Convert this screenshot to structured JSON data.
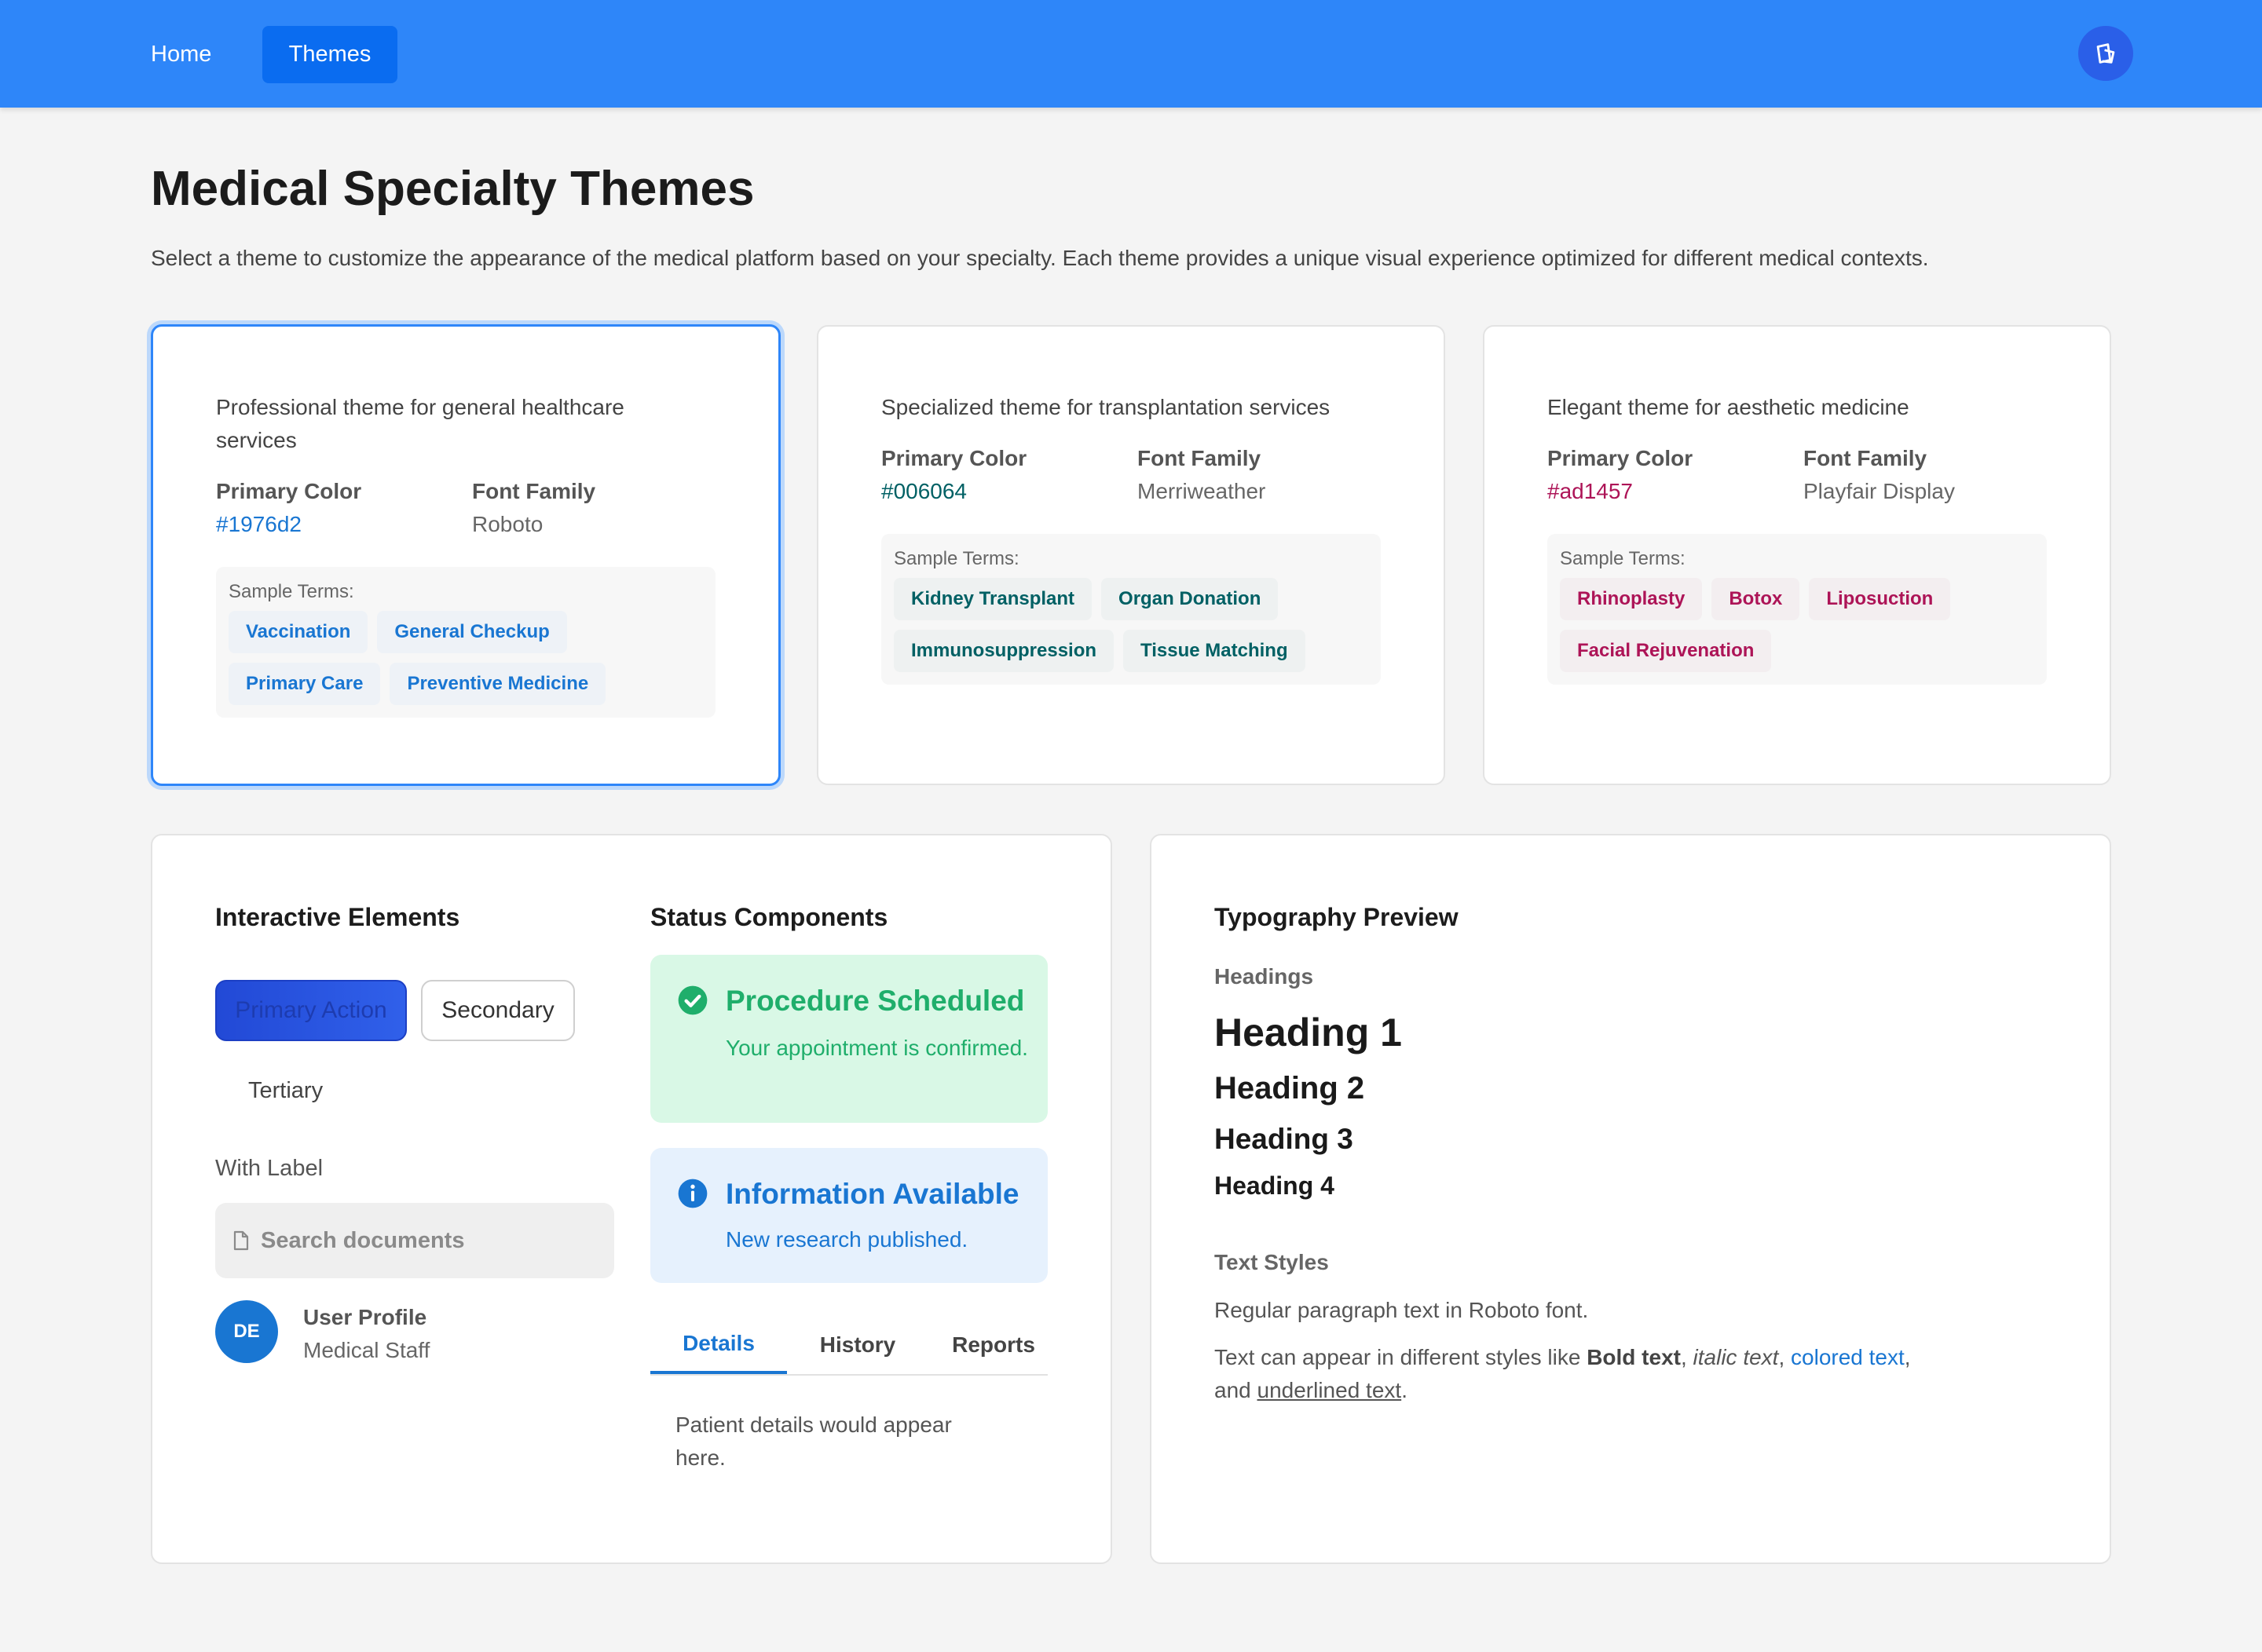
{
  "nav": {
    "home_label": "Home",
    "themes_label": "Themes",
    "avatar_icon": "theme-toggle-icon"
  },
  "page": {
    "title": "Medical Specialty Themes",
    "description": "Select a theme to customize the appearance of the medical platform based on your specialty. Each theme provides a unique visual experience optimized for different medical contexts."
  },
  "theme_cards": [
    {
      "description": "Professional theme for general healthcare services",
      "primary_color_label": "Primary Color",
      "primary_color": "#1976d2",
      "font_family_label": "Font Family",
      "font_family": "Roboto",
      "terms_label": "Sample Terms:",
      "terms": [
        "Vaccination",
        "General Checkup",
        "Primary Care",
        "Preventive Medicine"
      ],
      "chip_bg": "#eef2f7",
      "selected": true
    },
    {
      "description": "Specialized theme for transplantation services",
      "primary_color_label": "Primary Color",
      "primary_color": "#006064",
      "font_family_label": "Font Family",
      "font_family": "Merriweather",
      "terms_label": "Sample Terms:",
      "terms": [
        "Kidney Transplant",
        "Organ Donation",
        "Immunosuppression",
        "Tissue Matching"
      ],
      "chip_bg": "#eef1f1",
      "selected": false
    },
    {
      "description": "Elegant theme for aesthetic medicine",
      "primary_color_label": "Primary Color",
      "primary_color": "#ad1457",
      "font_family_label": "Font Family",
      "font_family": "Playfair Display",
      "terms_label": "Sample Terms:",
      "terms": [
        "Rhinoplasty",
        "Botox",
        "Liposuction",
        "Facial Rejuvenation"
      ],
      "chip_bg": "#f3eef0",
      "selected": false
    }
  ],
  "interactive": {
    "title": "Interactive Elements",
    "primary_button": "Primary Action",
    "secondary_button": "Secondary",
    "tertiary_button": "Tertiary",
    "field_label": "With Label",
    "search_placeholder": "Search documents",
    "avatar_initials": "DE",
    "profile_name": "User Profile",
    "profile_role": "Medical Staff"
  },
  "status": {
    "title": "Status Components",
    "success": {
      "title": "Procedure Scheduled",
      "message": "Your appointment is confirmed.",
      "color": "#1fae6b"
    },
    "info": {
      "title": "Information Available",
      "message": "New research published.",
      "color": "#1976d2"
    },
    "tabs": [
      "Details",
      "History",
      "Reports"
    ],
    "active_tab": "Details",
    "tab_content": "Patient details would appear here."
  },
  "typography": {
    "title": "Typography Preview",
    "headings_label": "Headings",
    "h1": "Heading 1",
    "h2": "Heading 2",
    "h3": "Heading 3",
    "h4": "Heading 4",
    "text_styles_label": "Text Styles",
    "regular_text": "Regular paragraph text in Roboto font.",
    "styles_prefix": "Text can appear in different styles like ",
    "bold_text": "Bold text",
    "sep1": ", ",
    "italic_text": "italic text",
    "sep2": ", ",
    "colored_text": "colored text",
    "sep3": ",",
    "and_text": "and ",
    "underlined_text": "underlined text",
    "end": ".",
    "accent_color": "#1976d2"
  }
}
